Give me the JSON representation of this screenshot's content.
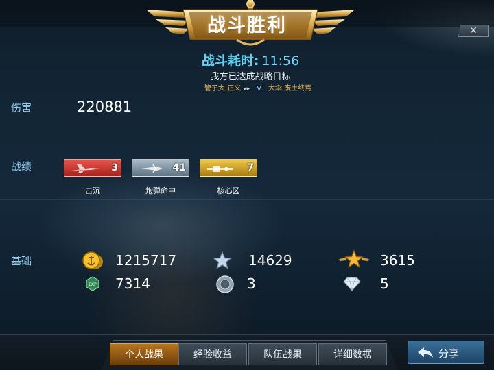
{
  "header": {
    "title": "战斗胜利",
    "close_label": "✕"
  },
  "summary": {
    "time_label": "战斗耗时:",
    "time_value": "11:56",
    "objective": "我方已达成战略目标",
    "player_left": "管子大|正义",
    "player_left_mark": "▸▸",
    "vs": "V",
    "player_right": "大伞·废土终焉"
  },
  "sections": {
    "damage_label": "伤害",
    "record_label": "战绩",
    "base_label": "基础"
  },
  "damage": {
    "value": "220881"
  },
  "medals": [
    {
      "count": "3",
      "caption": "击沉",
      "color": "#c4302b",
      "icon": "plane-icon"
    },
    {
      "count": "41",
      "caption": "炮弹命中",
      "color": "#7f93a3",
      "icon": "shell-icon"
    },
    {
      "count": "7",
      "caption": "核心区",
      "color": "#caa12a",
      "icon": "gun-icon"
    }
  ],
  "base_stats": {
    "gold": "1215717",
    "star_silver": "14629",
    "star_gold": "3615",
    "exp": "7314",
    "silver_coin": "3",
    "diamond": "5"
  },
  "tabs": [
    {
      "label": "个人战果",
      "active": true
    },
    {
      "label": "经验收益",
      "active": false
    },
    {
      "label": "队伍战果",
      "active": false
    },
    {
      "label": "详细数据",
      "active": false
    }
  ],
  "share": {
    "label": "分享"
  },
  "colors": {
    "accent_cyan": "#5fd1f5",
    "label_blue": "#8fd0f3",
    "player_gold": "#e9b34a",
    "active_tab": "#b8741e"
  }
}
